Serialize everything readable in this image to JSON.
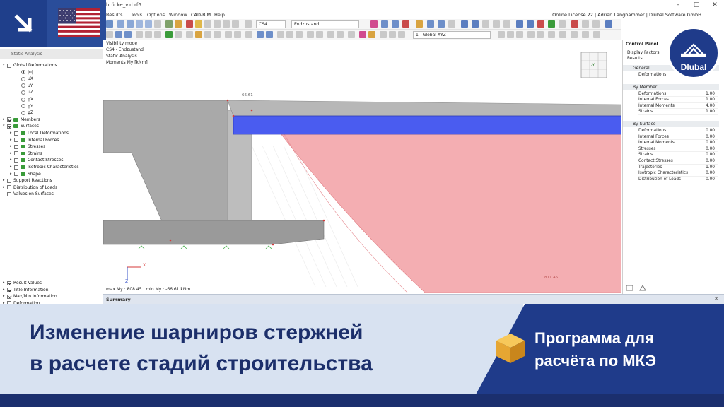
{
  "window": {
    "title": "brücke_vid.rf6",
    "license": "Online License 22 | Adrian Langhammer | Dlubal Software GmbH",
    "controls": {
      "minimize": "–",
      "maximize": "□",
      "close": "✕"
    }
  },
  "menu": [
    "Results",
    "Tools",
    "Options",
    "Window",
    "CAD-BIM",
    "Help"
  ],
  "toolbar": {
    "loadcase_id": "CS4",
    "loadcase_name": "Endzustand",
    "view_select": "1 - Global XYZ"
  },
  "navigator": {
    "header": "Static Analysis",
    "items": [
      {
        "label": "Global Deformations",
        "kind": "check",
        "checked": false,
        "indent": 0,
        "twisty": "▾"
      },
      {
        "label": "|u|",
        "kind": "radio",
        "checked": true,
        "indent": 2
      },
      {
        "label": "uX",
        "kind": "radio",
        "checked": false,
        "indent": 2
      },
      {
        "label": "uY",
        "kind": "radio",
        "checked": false,
        "indent": 2
      },
      {
        "label": "uZ",
        "kind": "radio",
        "checked": false,
        "indent": 2
      },
      {
        "label": "φX",
        "kind": "radio",
        "checked": false,
        "indent": 2
      },
      {
        "label": "φY",
        "kind": "radio",
        "checked": false,
        "indent": 2
      },
      {
        "label": "φZ",
        "kind": "radio",
        "checked": false,
        "indent": 2
      },
      {
        "label": "Members",
        "kind": "check",
        "checked": true,
        "indent": 0,
        "twisty": "▸",
        "icon": "#3a9b3a"
      },
      {
        "label": "Surfaces",
        "kind": "check",
        "checked": true,
        "indent": 0,
        "twisty": "▾",
        "icon": "#3a9b3a"
      },
      {
        "label": "Local Deformations",
        "kind": "check",
        "checked": false,
        "indent": 1,
        "twisty": "▸",
        "icon": "#3a9b3a"
      },
      {
        "label": "Internal Forces",
        "kind": "check",
        "checked": false,
        "indent": 1,
        "twisty": "▸",
        "icon": "#3a9b3a"
      },
      {
        "label": "Stresses",
        "kind": "check",
        "checked": false,
        "indent": 1,
        "twisty": "▸",
        "icon": "#3a9b3a"
      },
      {
        "label": "Strains",
        "kind": "check",
        "checked": false,
        "indent": 1,
        "twisty": "▸",
        "icon": "#3a9b3a"
      },
      {
        "label": "Contact Stresses",
        "kind": "check",
        "checked": false,
        "indent": 1,
        "twisty": "▸",
        "icon": "#3a9b3a"
      },
      {
        "label": "Isotropic Characteristics",
        "kind": "check",
        "checked": false,
        "indent": 1,
        "twisty": "▸",
        "icon": "#3a9b3a"
      },
      {
        "label": "Shape",
        "kind": "check",
        "checked": false,
        "indent": 1,
        "twisty": "▸",
        "icon": "#3a9b3a"
      },
      {
        "label": "Support Reactions",
        "kind": "check",
        "checked": false,
        "indent": 0,
        "twisty": "▸"
      },
      {
        "label": "Distribution of Loads",
        "kind": "check",
        "checked": false,
        "indent": 0,
        "twisty": "▸"
      },
      {
        "label": "Values on Surfaces",
        "kind": "check",
        "checked": false,
        "indent": 0,
        "twisty": ""
      }
    ],
    "bottom_items": [
      {
        "label": "Result Values",
        "checked": true
      },
      {
        "label": "Title Information",
        "checked": true
      },
      {
        "label": "Max/Min Information",
        "checked": true
      },
      {
        "label": "Deformation",
        "checked": false
      }
    ]
  },
  "viewport": {
    "info_lines": [
      "Visibility mode",
      "CS4 - Endzustand",
      "Static Analysis",
      "Moments My [kNm]"
    ],
    "label_top": "66.61",
    "label_bottom": "811.45",
    "minmax": "max My : 808.45 | min My : -66.61 kNm",
    "axis_x": "X",
    "axis_z": "Z",
    "cube_label": "-Y"
  },
  "control_panel": {
    "title": "Control Panel",
    "subtitle_1": "Display Factors",
    "subtitle_2": "Results",
    "sections": [
      {
        "name": "General",
        "rows": [
          {
            "label": "Deformations",
            "value": ""
          }
        ]
      },
      {
        "name": "By Member",
        "rows": [
          {
            "label": "Deformations",
            "value": "1.00"
          },
          {
            "label": "Internal Forces",
            "value": "1.00"
          },
          {
            "label": "Internal Moments",
            "value": "4.00"
          },
          {
            "label": "Strains",
            "value": "1.00"
          }
        ]
      },
      {
        "name": "By Surface",
        "rows": [
          {
            "label": "Deformations",
            "value": "0.00"
          },
          {
            "label": "Internal Forces",
            "value": "0.00"
          },
          {
            "label": "Internal Moments",
            "value": "0.00"
          },
          {
            "label": "Stresses",
            "value": "0.00"
          },
          {
            "label": "Strains",
            "value": "0.00"
          },
          {
            "label": "Contact Stresses",
            "value": "0.00"
          },
          {
            "label": "Trajectories",
            "value": "1.00"
          },
          {
            "label": "Isotropic Characteristics",
            "value": "0.00"
          },
          {
            "label": "Distribution of Loads",
            "value": "0.00"
          }
        ]
      }
    ]
  },
  "summary": {
    "title": "Summary",
    "pin": "📌",
    "close": "✕"
  },
  "logo": {
    "text": "Dlubal"
  },
  "banner": {
    "headline_1": "Изменение шарниров стержней",
    "headline_2": "в расчете стадий строительства",
    "subline_1": "Программа для",
    "subline_2": "расчёта по МКЭ"
  },
  "colors": {
    "brand_dark": "#1f3b8a",
    "banner_light": "#d8e2f1",
    "moment_fill": "#f2a0a4",
    "beam_blue": "#4a5cf0"
  }
}
